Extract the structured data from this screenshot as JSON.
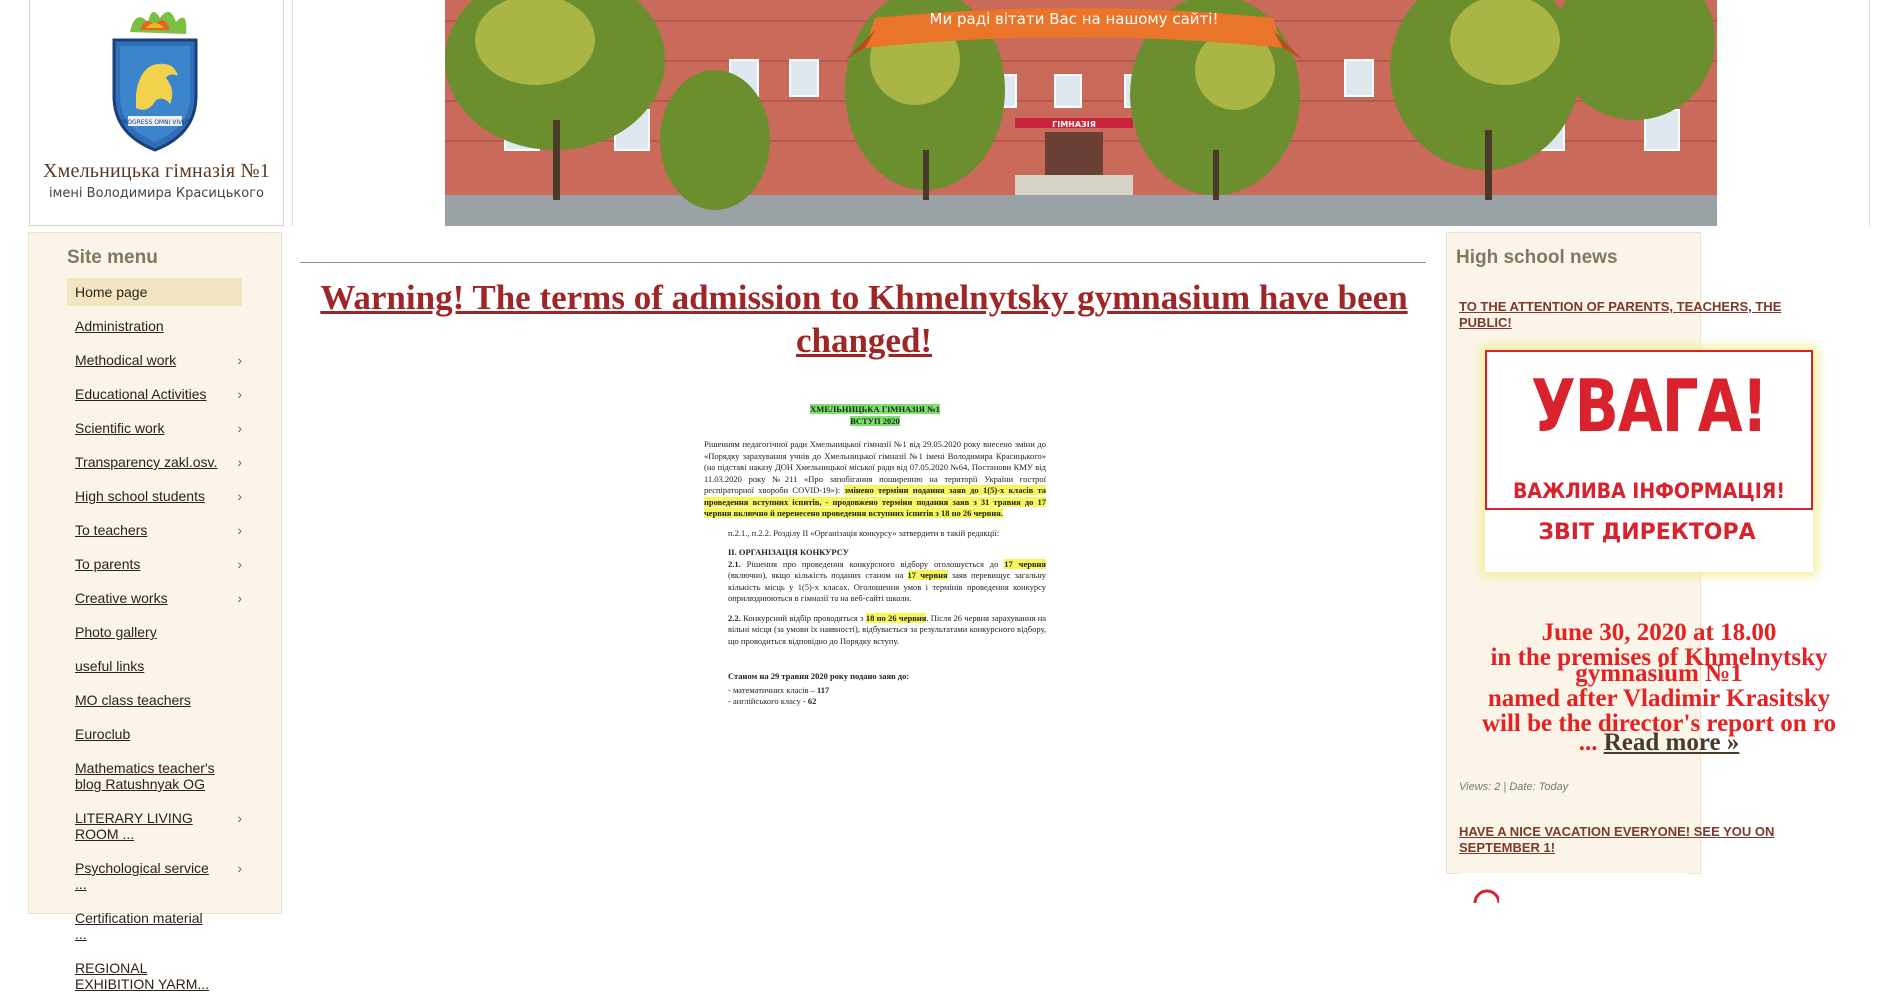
{
  "header": {
    "title": "Хмельницька гімназія №1",
    "subtitle": "імені Володимира Красицького",
    "banner_greeting": "Ми раді вітати Вас на нашому сайті!",
    "building_sign": "ГІМНАЗІЯ",
    "emblem_motto": "PROGRESS OMNI VIVUS"
  },
  "sidebar": {
    "title": "Site menu",
    "items": [
      {
        "label": "Home page"
      },
      {
        "label": "Administration"
      },
      {
        "label": "Methodical work"
      },
      {
        "label": "Educational Activities"
      },
      {
        "label": "Scientific work"
      },
      {
        "label": "Transparency zakl.osv."
      },
      {
        "label": "High school students"
      },
      {
        "label": "To teachers"
      },
      {
        "label": "To parents"
      },
      {
        "label": "Creative works"
      },
      {
        "label": "Photo gallery"
      },
      {
        "label": "useful links"
      },
      {
        "label": "MO class teachers"
      },
      {
        "label": "Euroclub"
      },
      {
        "label": "Mathematics teacher's blog Ratushnyak OG"
      },
      {
        "label": "LITERARY LIVING ROOM ..."
      },
      {
        "label": "Psychological service ..."
      },
      {
        "label": "Certification material ..."
      },
      {
        "label": "REGIONAL EXHIBITION YARM..."
      }
    ]
  },
  "article": {
    "title": "Warning! The terms of admission to Khmelnytsky gymnasium have been changed!",
    "doc": {
      "head1": "ХМЕЛЬНИЦЬКА ГІМНАЗІЯ №1",
      "head2": "ВСТУП 2020",
      "p1": "Рішенням педагогічної ради Хмельницької гімназії №1 від 29.05.2020 року внесено зміни до «Порядку зарахування учнів до Хмельницької гімназії №1 імені Володимира Красицького» (на підставі наказу ДОН Хмельницької міської ради від 07.05.2020 №64, Постанови КМУ від 11.03.2020 року №211 «Про запобігання поширенню на території України гострої респіраторної хвороби COVID-19»):",
      "p1_hl": "змінено терміни подання заяв до 1(5)-х класів та проведення вступних іспитів, - продовжено терміни подання заяв з 31 травня до 17 червня включно й перенесено проведення вступних іспитів з 18 по 26 червня.",
      "p2": "п.2.1., п.2.2. Розділу ІІ «Організація конкурсу» затвердити в такій редакції:",
      "sec": "ІІ. ОРГАНІЗАЦІЯ КОНКУРСУ",
      "s21a": "2.1.",
      "s21b": "Рішення про проведення конкурсного відбору оголошується до",
      "s21c": "17 червня",
      "s21d": "(включно), якщо кількість поданих станом на",
      "s21e": "17 червня",
      "s21f": "заяв перевищує загальну кількість місць у 1(5)-х класах. Оголошення умов і термінів проведення конкурсу оприлюднюються в гімназії та на веб-сайті школи.",
      "s22a": "2.2.",
      "s22b": "Конкурсний відбір проводяться з",
      "s22c": "18 по 26 червня",
      "s22d": ". Після 26 червня зарахування на вільні місця (за умови їх наявності), відбувається за результатами конкурсного відбору, що проводиться відповідно до Порядку вступу.",
      "stat": "Станом на 29 травня 2020 року подано заяв до:",
      "stat1": "-   математичних класів –",
      "stat1v": "117",
      "stat2": "-   англійського класу -",
      "stat2v": "62"
    }
  },
  "news": {
    "title": "High school news",
    "item1_heading": "TO THE ATTENTION OF PARENTS, TEACHERS, THE PUBLIC!",
    "poster_big": "УВАГА!",
    "poster_mid": "ВАЖЛИВА ІНФОРМАЦІЯ!",
    "poster_small": "ЗВІТ ДИРЕКТОРА",
    "event_lines": [
      "June 30, 2020 at 18.00",
      "in the premises of Khmelnytsky",
      "gymnasium №1",
      "named after Vladimir Krasitsky",
      "will be the director's report on ro"
    ],
    "ellipsis": "...",
    "read_more": "Read more »",
    "meta": "Views: 2 | Date: Today",
    "item2_heading": "HAVE A NICE VACATION EVERYONE! SEE YOU ON SEPTEMBER 1!"
  },
  "colors": {
    "title_red": "#9e2626",
    "sidebar_bg": "#faf5e8",
    "active_bg": "#f2e5c1",
    "poster_red": "#d8232e"
  }
}
